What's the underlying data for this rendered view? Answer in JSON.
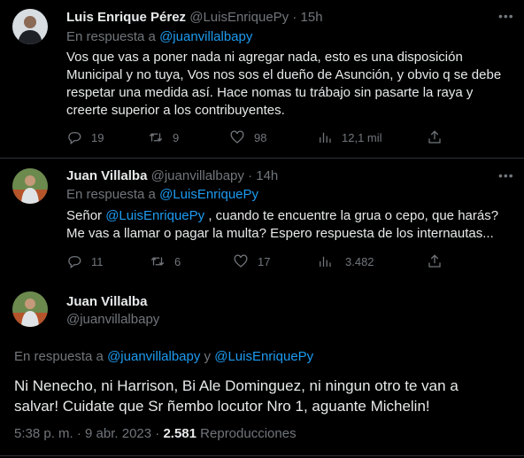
{
  "tweet1": {
    "name": "Luis Enrique Pérez",
    "handle": "@LuisEnriquePy",
    "dot": "·",
    "time": "15h",
    "reply_prefix": "En respuesta a",
    "reply_to": "@juanvillalbapy",
    "text_lines": [
      "Vos que vas a poner nada ni agregar nada, esto es una disposición",
      "Municipal y no tuya, Vos nos sos el dueño de Asunción, y obvio q se debe",
      "respetar una medida así. Hace nomas tu trábajo sin pasarte la raya y",
      "creerte superior a los contribuyentes."
    ],
    "replies": "19",
    "retweets": "9",
    "likes": "98",
    "views": "12,1 mil"
  },
  "tweet2": {
    "name": "Juan Villalba",
    "handle": "@juanvillalbapy",
    "dot": "·",
    "time": "14h",
    "reply_prefix": "En respuesta a",
    "reply_to": "@LuisEnriquePy",
    "text_start": "Señor ",
    "mention": "@LuisEnriquePy",
    "text_rest": " , cuando te encuentre la grua o cepo, que harás?",
    "text_line2": "Me vas a llamar o pagar la multa? Espero respuesta de los internautas...",
    "replies": "11",
    "retweets": "6",
    "likes": "17",
    "views": "3.482"
  },
  "tweet3": {
    "name": "Juan Villalba",
    "handle": "@juanvillalbapy",
    "reply_prefix": "En respuesta a",
    "reply_to1": "@juanvillalbapy",
    "reply_and": "y",
    "reply_to2": "@LuisEnriquePy",
    "text_line1": "Ni Nenecho,  ni Harrison, Bi Ale Dominguez, ni ningun otro te van a",
    "text_line2": "salvar! Cuidate que Sr ñembo locutor Nro 1,  aguante Michelin!",
    "timestamp": "5:38 p. m. · 9 abr. 2023",
    "views_count": "2.581",
    "views_label": "Reproducciones"
  },
  "icons": {
    "more": "more-icon",
    "reply": "reply-icon",
    "retweet": "retweet-icon",
    "like": "like-icon",
    "views": "views-icon",
    "share": "share-icon"
  },
  "colors": {
    "background": "#000000",
    "text": "#e7e9ea",
    "muted": "#71767b",
    "link": "#1d9bf0",
    "divider": "#2f3336"
  }
}
